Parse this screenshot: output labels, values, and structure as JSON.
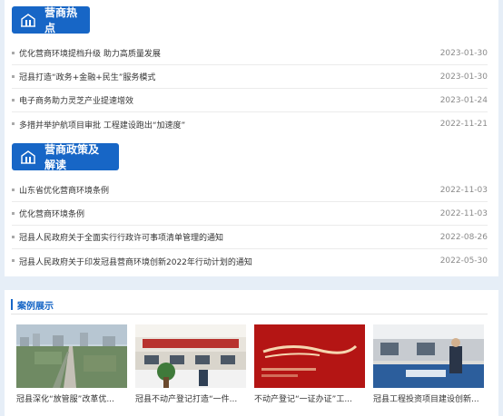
{
  "sections": {
    "hot": {
      "title": "营商热点",
      "items": [
        {
          "title": "优化营商环境提档升级 助力高质量发展",
          "date": "2023-01-30"
        },
        {
          "title": "冠县打造“政务+金融+民生”服务模式",
          "date": "2023-01-30"
        },
        {
          "title": "电子商务助力灵芝产业提速增效",
          "date": "2023-01-24"
        },
        {
          "title": "多措并举护航项目审批 工程建设跑出“加速度”",
          "date": "2022-11-21"
        }
      ]
    },
    "policy": {
      "title": "营商政策及解读",
      "items": [
        {
          "title": "山东省优化营商环境条例",
          "date": "2022-11-03"
        },
        {
          "title": "优化营商环境条例",
          "date": "2022-11-03"
        },
        {
          "title": "冠县人民政府关于全面实行行政许可事项清单管理的通知",
          "date": "2022-08-26"
        },
        {
          "title": "冠县人民政府关于印发冠县营商环境创新2022年行动计划的通知",
          "date": "2022-05-30"
        }
      ]
    }
  },
  "cases": {
    "title": "案例展示",
    "items": [
      {
        "caption": "冠县深化“放管服”改革优...",
        "image_icon": "city-aerial-photo"
      },
      {
        "caption": "冠县不动产登记打造“一件...",
        "image_icon": "service-hall-photo"
      },
      {
        "caption": "不动产登记“一证办证”工...",
        "image_icon": "red-banner-photo"
      },
      {
        "caption": "冠县工程投资项目建设创新...",
        "image_icon": "counter-service-photo"
      }
    ]
  },
  "colors": {
    "accent": "#1766c6",
    "date": "#8a8a8a",
    "background": "#e6eef7"
  }
}
